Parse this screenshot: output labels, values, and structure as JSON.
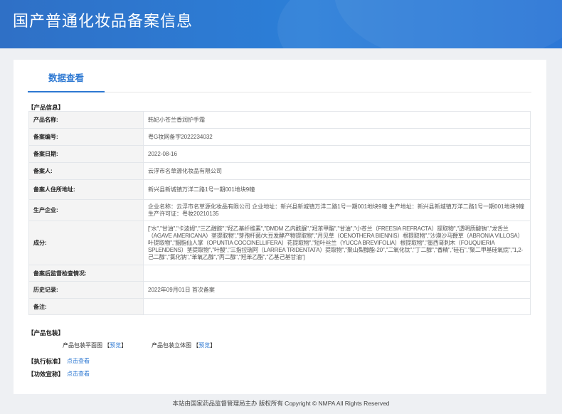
{
  "header": {
    "title": "国产普通化妆品备案信息"
  },
  "tabs": [
    {
      "label": "数据查看",
      "active": true
    }
  ],
  "sections": {
    "product_info": "【产品信息】",
    "packaging": "【产品包装】",
    "standard": "【执行标准】",
    "efficacy": "【功效宣称】"
  },
  "product_info_rows": [
    {
      "key": "产品名称:",
      "value": "韩妃小苍兰香润护手霜"
    },
    {
      "key": "备案编号:",
      "value": "粤G妆网备字2022234032"
    },
    {
      "key": "备案日期:",
      "value": "2022-08-16"
    },
    {
      "key": "备案人:",
      "value": "云浮市名草源化妆品有限公司"
    },
    {
      "key": "备案人住所地址:",
      "value": "新兴县新城镇万洋二路1号一期001地块9幢"
    },
    {
      "key": "生产企业:",
      "value": "企业名称：云浮市名草源化妆品有限公司 企业地址：新兴县新城镇万洋二路1号一期001地块9幢 生产地址：新兴县新城镇万洋二路1号一期001地块9幢 生产许可证：粤妆20210135"
    },
    {
      "key": "成分:",
      "value": "[\"水\",\"甘油\",\"卡波姆\",\"三乙醇胺\",\"羟乙基纤维素\",\"DMDM 乙内酰脲\",\"羟苯甲酯\",\"甘油\",\"小苍兰（FREESIA REFRACTA）提取物\",\"透明质酸钠\",\"龙舌兰（AGAVE AMERICANA）茎提取物\",\"芽孢杆菌/大豆发酵产物提取物\",\"月见草（OENOTHERA BIENNIS）根提取物\",\"沙漠沙马鞭草（ABRONIA VILLOSA）叶提取物\",\"胭脂仙人掌（OPUNTIA COCCINELLIFERA）花提取物\",\"短叶丝兰（YUCCA BREVIFOLIA）根提取物\",\"墨西哥刺木（FOUQUIERIA SPLENDENS）茎提取物\",\"叶酸\",\"三指拉瑞阿（LARREA TRIDENTATA）提取物\",\"聚山梨醇酯-20\",\"二氧化钛\",\"丁二醇\",\"香精\",\"硅石\",\"聚二甲基硅氧烷\",\"1,2-己二醇\",\"氯化钠\",\"苯氧乙醇\",\"丙二醇\",\"羟苯乙酯\",\"乙基己基甘油\"]"
    },
    {
      "key": "备案后监督检查情况:",
      "value": ""
    },
    {
      "key": "历史记录:",
      "value": "2022年09月01日 首次备案"
    },
    {
      "key": "备注:",
      "value": ""
    }
  ],
  "packaging": {
    "flat_label": "产品包装平面图",
    "stereo_label": "产品包装立体图",
    "preview_link": "预览",
    "bracket_open": "【",
    "bracket_close": "】"
  },
  "standard_link": "点击查看",
  "efficacy_link": "点击查看",
  "footer": {
    "text": "本站由国家药品监督管理局主办 版权所有 Copyright © NMPA All Rights Reserved"
  },
  "colors": {
    "banner": "#2c7fd8",
    "accent": "#2d78d2",
    "table_border": "#9fc0e4"
  }
}
